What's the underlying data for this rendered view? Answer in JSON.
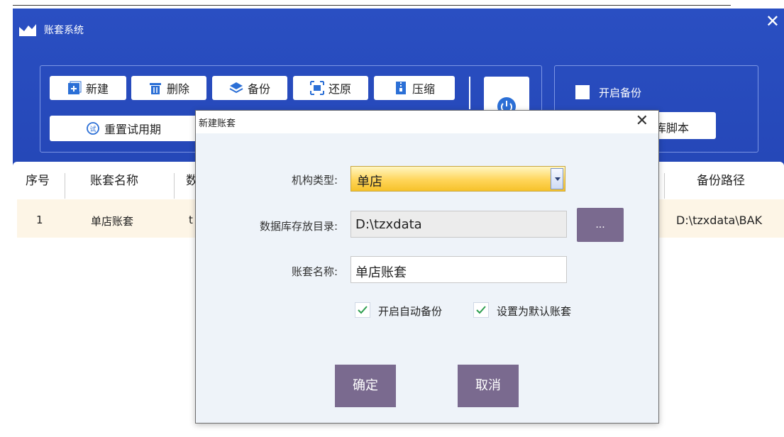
{
  "window": {
    "title": "账套系统"
  },
  "toolbar": {
    "new": "新建",
    "delete": "删除",
    "backup": "备份",
    "restore": "还原",
    "compress": "压缩",
    "reset_trial": "重置试用期"
  },
  "options": {
    "enable_backup": "开启备份",
    "script_button": "库脚本"
  },
  "table": {
    "headers": {
      "index": "序号",
      "name": "账套名称",
      "col3_partial": "数",
      "backup_path": "备份路径"
    },
    "rows": [
      {
        "index": "1",
        "name": "单店账套",
        "col3_partial": "t",
        "backup_path": "D:\\tzxdata\\BAK"
      }
    ]
  },
  "dialog": {
    "title": "新建账套",
    "org_type_label": "机构类型:",
    "org_type_value": "单店",
    "db_dir_label": "数据库存放目录:",
    "db_dir_value": "D:\\tzxdata",
    "browse_label": "...",
    "account_name_label": "账套名称:",
    "account_name_value": "单店账套",
    "auto_backup_label": "开启自动备份",
    "auto_backup_checked": true,
    "default_account_label": "设置为默认账套",
    "default_account_checked": true,
    "ok_label": "确定",
    "cancel_label": "取消"
  },
  "colors": {
    "window_bg": "#1f3fae",
    "dialog_bg": "#eef3f9",
    "button_purple": "#7a6a8f",
    "select_yellow": "#ffd55a",
    "check_green": "#2e9e4f"
  }
}
